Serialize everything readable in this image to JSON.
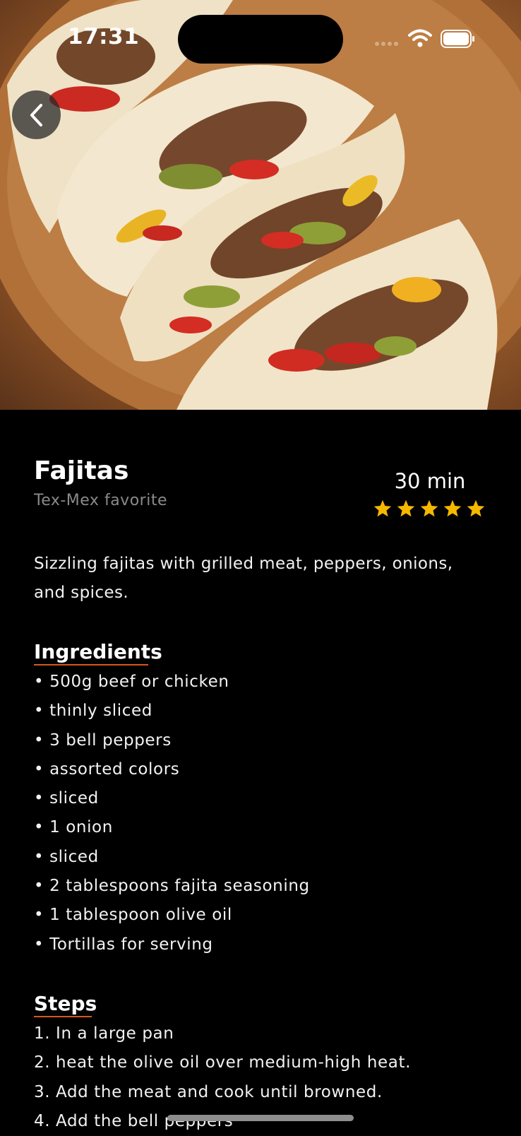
{
  "status_bar": {
    "time": "17:31"
  },
  "recipe": {
    "title": "Fajitas",
    "subtitle": "Tex-Mex favorite",
    "duration": "30 min",
    "rating": 5,
    "rating_max": 5,
    "description": "Sizzling fajitas with grilled meat, peppers, onions, and spices.",
    "ingredients_heading": "Ingredients",
    "ingredients": [
      "• 500g beef or chicken",
      "• thinly sliced",
      "• 3 bell peppers",
      "• assorted colors",
      "• sliced",
      "• 1 onion",
      "• sliced",
      "• 2 tablespoons fajita seasoning",
      "• 1 tablespoon olive oil",
      "• Tortillas for serving"
    ],
    "steps_heading": "Steps",
    "steps": [
      "1. In a large pan",
      "2. heat the olive oil over medium-high heat.",
      "3. Add the meat and cook until browned.",
      "4. Add the bell peppers"
    ]
  },
  "icons": {
    "back": "chevron-left-icon",
    "wifi": "wifi-icon",
    "battery": "battery-icon",
    "star": "star-icon"
  },
  "colors": {
    "background": "#000000",
    "star": "#f5b800",
    "accent_underline": "#d35a1a",
    "subtitle": "#8a8a8a"
  }
}
